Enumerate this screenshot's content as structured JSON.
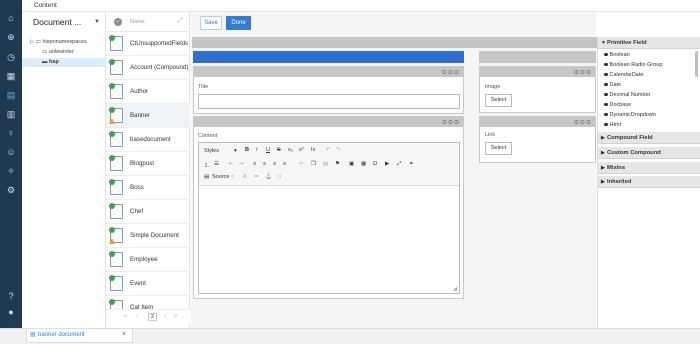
{
  "topbar": {
    "title": "Content"
  },
  "tree": {
    "header": "Document ...",
    "items": [
      "hisponamespaces",
      "unlewinter",
      "hap"
    ]
  },
  "list": {
    "column_header": "Name",
    "items": [
      {
        "label": "CtUnsupportedFields",
        "warn": false
      },
      {
        "label": "Account (Compound)",
        "warn": false
      },
      {
        "label": "Author",
        "warn": false
      },
      {
        "label": "Banner",
        "warn": true
      },
      {
        "label": "basedocument",
        "warn": false
      },
      {
        "label": "Blogpost",
        "warn": false
      },
      {
        "label": "Boss",
        "warn": false
      },
      {
        "label": "Chef",
        "warn": false
      },
      {
        "label": "Simple Document",
        "warn": true
      },
      {
        "label": "Employee",
        "warn": false
      },
      {
        "label": "Event",
        "warn": false
      },
      {
        "label": "Cat Item",
        "warn": false
      }
    ],
    "pager": {
      "first": "«",
      "prev": "‹",
      "page": "2",
      "next": "›",
      "last": "»"
    }
  },
  "editor": {
    "save_label": "Save",
    "done_label": "Done",
    "title_label": "Title",
    "content_label": "Content",
    "image_label": "Image",
    "link_label": "Link",
    "image_button": "Select",
    "link_button": "Select",
    "styles_label": "Styles",
    "source_label": "Source"
  },
  "right": {
    "sections": [
      "Primitive Field",
      "Compound Field",
      "Custom Compound",
      "Mixins",
      "Inherited"
    ],
    "primitive_fields": [
      "Boolean",
      "Boolean Radio Group",
      "CalendarDate",
      "Date",
      "Decimal Number",
      "Docbase",
      "DynamicDropdown",
      "Html"
    ]
  },
  "bottom": {
    "tab_label": "banner document",
    "close_icon": "×"
  },
  "colors": {
    "nav": "#1f3a50",
    "accent": "#2e7cd6",
    "header_blue": "#2f6fd1"
  }
}
